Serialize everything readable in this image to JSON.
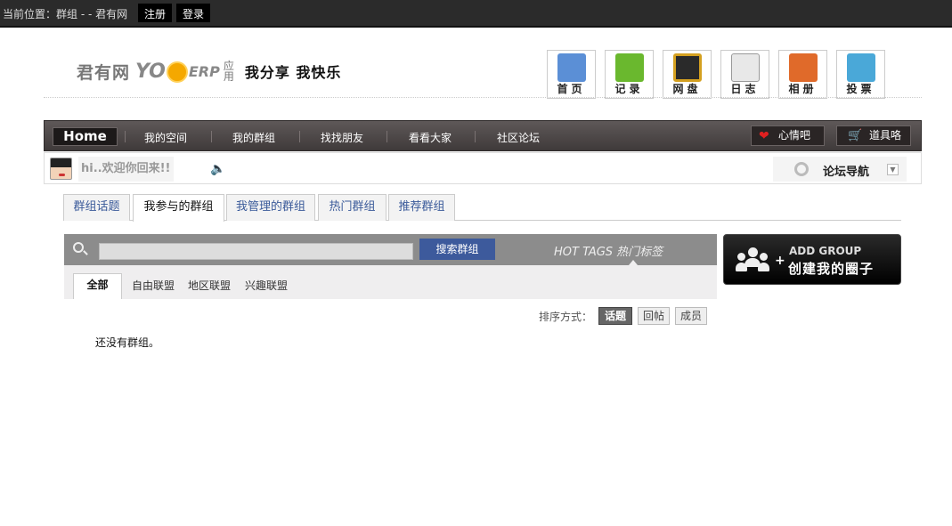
{
  "topbar": {
    "location_label": "当前位置：群组  - - 君有网",
    "register_label": "注册",
    "login_label": "登录"
  },
  "logo": {
    "site_name": "君有网",
    "brand_yo": "YO",
    "brand_erp": "ERP",
    "seal_text": "应用",
    "slogan": "我分享 我快乐"
  },
  "nav_icons": [
    {
      "label": "首页",
      "icon": "home-icon",
      "color": "#5b8fd6"
    },
    {
      "label": "记录",
      "icon": "record-icon",
      "color": "#6ab82e"
    },
    {
      "label": "网盘",
      "icon": "disk-icon",
      "color": "#d4a020"
    },
    {
      "label": "日志",
      "icon": "diary-icon",
      "color": "#b9b9b9"
    },
    {
      "label": "相册",
      "icon": "album-icon",
      "color": "#e06a2a"
    },
    {
      "label": "投票",
      "icon": "vote-icon",
      "color": "#4aa8d8"
    }
  ],
  "main_nav": {
    "home_label": "Home",
    "items": [
      "我的空间",
      "我的群组",
      "找找朋友",
      "看看大家",
      "社区论坛"
    ],
    "mood_label": "心情吧",
    "props_label": "道具咯"
  },
  "welcome": {
    "message": "hi..欢迎你回来!!",
    "forum_nav_label": "论坛导航"
  },
  "tabs": [
    "群组话题",
    "我参与的群组",
    "我管理的群组",
    "热门群组",
    "推荐群组"
  ],
  "active_tab": "我参与的群组",
  "search": {
    "placeholder": "",
    "button_label": "搜索群组",
    "hot_tags_label": "HOT TAGS 热门标签"
  },
  "filters": [
    "全部",
    "自由联盟",
    "地区联盟",
    "兴趣联盟"
  ],
  "add_group": {
    "en_label": "ADD GROUP",
    "cn_label": "创建我的圈子"
  },
  "sort": {
    "label": "排序方式：",
    "options": [
      "话题",
      "回帖",
      "成员"
    ]
  },
  "empty_message": "还没有群组。",
  "colors": {
    "accent_blue": "#3d5a9c",
    "nav_dark": "#4a4444",
    "topbar": "#2b2b2b"
  }
}
